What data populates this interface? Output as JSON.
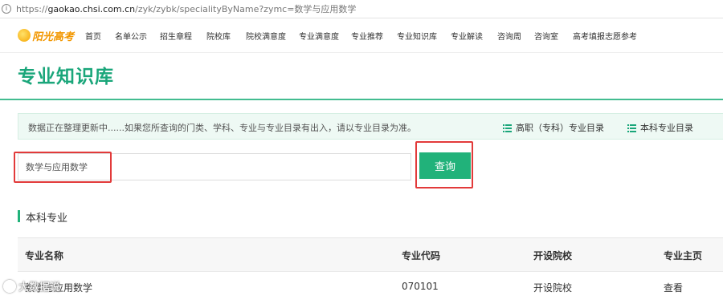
{
  "browser": {
    "url_prefix": "https://",
    "url_host": "gaokao.chsi.com.cn",
    "url_path": "/zyk/zybk/specialityByName?zymc=数学与应用数学"
  },
  "nav": {
    "logo_text": "阳光高考",
    "items": [
      "首页",
      "名单公示",
      "招生章程",
      "院校库",
      "院校满意度",
      "专业满意度",
      "专业推荐",
      "专业知识库",
      "专业解读",
      "咨询周",
      "咨询室",
      "高考填报志愿参考"
    ]
  },
  "page_title": "专业知识库",
  "notice": {
    "message": "数据正在整理更新中......如果您所查询的门类、学科、专业与专业目录有出入，请以专业目录为准。",
    "link_vocational": "高职（专科）专业目录",
    "link_undergrad": "本科专业目录"
  },
  "search": {
    "value": "数学与应用数学",
    "button_label": "查询"
  },
  "section_title": "本科专业",
  "table": {
    "headers": [
      "专业名称",
      "专业代码",
      "开设院校",
      "专业主页"
    ],
    "rows": [
      {
        "name": "数学与应用数学",
        "code": "070101",
        "schools": "开设院校",
        "home": "查看"
      }
    ]
  },
  "watermark": "大数据说"
}
